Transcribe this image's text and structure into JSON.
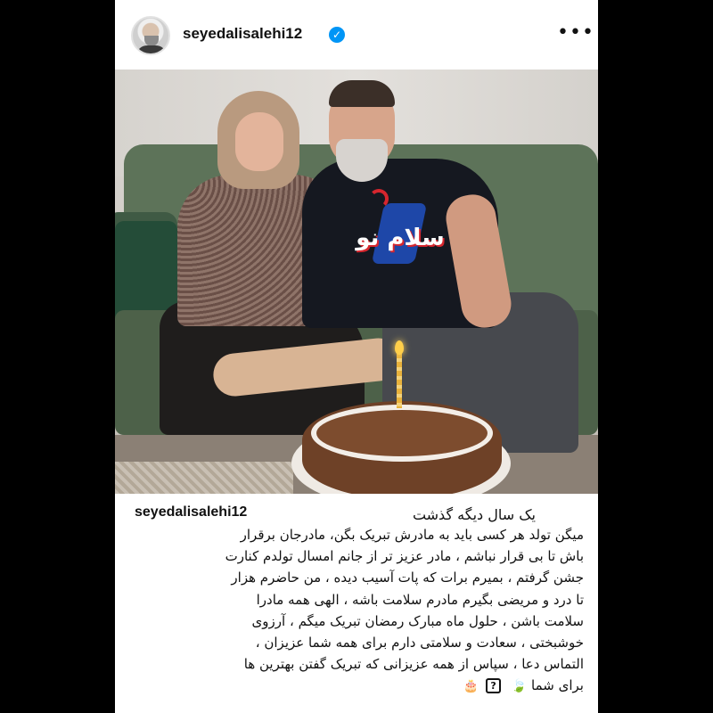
{
  "post": {
    "username": "seyedalisalehi12",
    "verified_icon": "verified-badge-icon",
    "more_icon": "more-options-icon",
    "more_label": "•••"
  },
  "photo": {
    "overlay_logo_text": "سلام نو"
  },
  "caption": {
    "username": "seyedalisalehi12",
    "first_line": "یک سال دیگه گذشت",
    "lines": [
      "میگن تولد هر کسی باید به مادرش تبریک بگن، مادرجان برقرار",
      "باش تا بی قرار نباشم ، مادر عزیز تر از جانم امسال تولدم کنارت",
      "جشن گرفتم ، بمیرم برات که پات آسیب دیده ، من حاضرم هزار",
      "تا درد و مریضی بگیرم مادرم سلامت باشه ، الهی همه مادرا",
      "سلامت باشن ، حلول ماه مبارک رمضان تبریک میگم ، آرزوی",
      "خوشبختی ، سعادت و سلامتی دارم برای همه شما عزیزان ،",
      "التماس دعا ، سپاس از همه عزیزانی که تبریک گفتن بهترین ها",
      "برای شما"
    ],
    "emojis": [
      "🍃",
      "?",
      "🎂"
    ]
  }
}
